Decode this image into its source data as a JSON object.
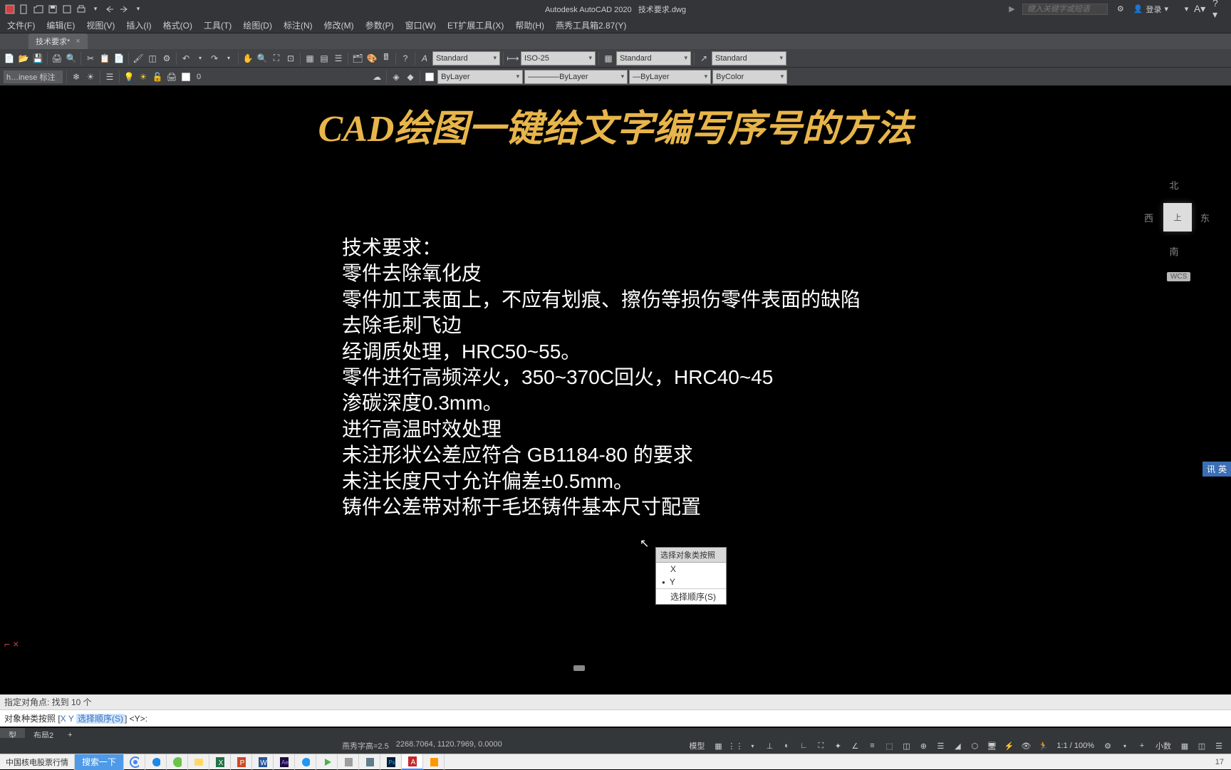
{
  "titlebar": {
    "app": "Autodesk AutoCAD 2020",
    "doc": "技术要求.dwg",
    "search_placeholder": "键入关键字或短语",
    "login": "登录"
  },
  "menus": [
    "文件(F)",
    "编辑(E)",
    "视图(V)",
    "插入(I)",
    "格式(O)",
    "工具(T)",
    "绘图(D)",
    "标注(N)",
    "修改(M)",
    "参数(P)",
    "窗口(W)",
    "ET扩展工具(X)",
    "帮助(H)",
    "燕秀工具箱2.87(Y)"
  ],
  "filetab": {
    "name": "技术要求*",
    "close": "×"
  },
  "toolbar1": {
    "styles": [
      "Standard",
      "ISO-25",
      "Standard",
      "Standard"
    ]
  },
  "toolbar2": {
    "layer_name": "h…inese 标注",
    "zero": "0",
    "props": [
      "ByLayer",
      "ByLayer",
      "ByLayer",
      "ByColor"
    ]
  },
  "canvas": {
    "title": "CAD绘图一键给文字编写序号的方法",
    "lines": [
      "技术要求：",
      "零件去除氧化皮",
      "零件加工表面上，不应有划痕、擦伤等损伤零件表面的缺陷",
      "去除毛刺飞边",
      "经调质处理，HRC50~55。",
      "零件进行高频淬火，350~370C回火，HRC40~45",
      "渗碳深度0.3mm。",
      "进行高温时效处理",
      "未注形状公差应符合 GB1184-80 的要求",
      "未注长度尺寸允许偏差±0.5mm。",
      "铸件公差带对称于毛坯铸件基本尺寸配置"
    ]
  },
  "context_menu": {
    "title": "选择对象类按照",
    "opt_x": "X",
    "opt_y": "Y",
    "order": "选择顺序(S)"
  },
  "viewcube": {
    "n": "北",
    "s": "南",
    "e": "东",
    "w": "西",
    "top": "上",
    "wcs": "WCS"
  },
  "ime": {
    "a": "讯",
    "b": "英"
  },
  "ucs": {
    "a": "⌐",
    "b": "×"
  },
  "cmd": {
    "line1": "指定对角点: 找到 10 个",
    "line2_pre": "对象种类按照 [",
    "line2_x": "X",
    "line2_y": "Y",
    "line2_order": "选择顺序(S)",
    "line2_post": "] <Y>:"
  },
  "layout": {
    "tabs": [
      "型",
      "布局2"
    ],
    "add": "+"
  },
  "status": {
    "yanxiu": "燕秀字高=2.5",
    "coords": "2268.7064, 1120.7969, 0.0000",
    "model": "模型",
    "scale": "1:1 / 100%",
    "decimal": "小数",
    "right_num": "17"
  },
  "taskbar": {
    "left": "中国核电股票行情",
    "search": "搜索一下"
  }
}
